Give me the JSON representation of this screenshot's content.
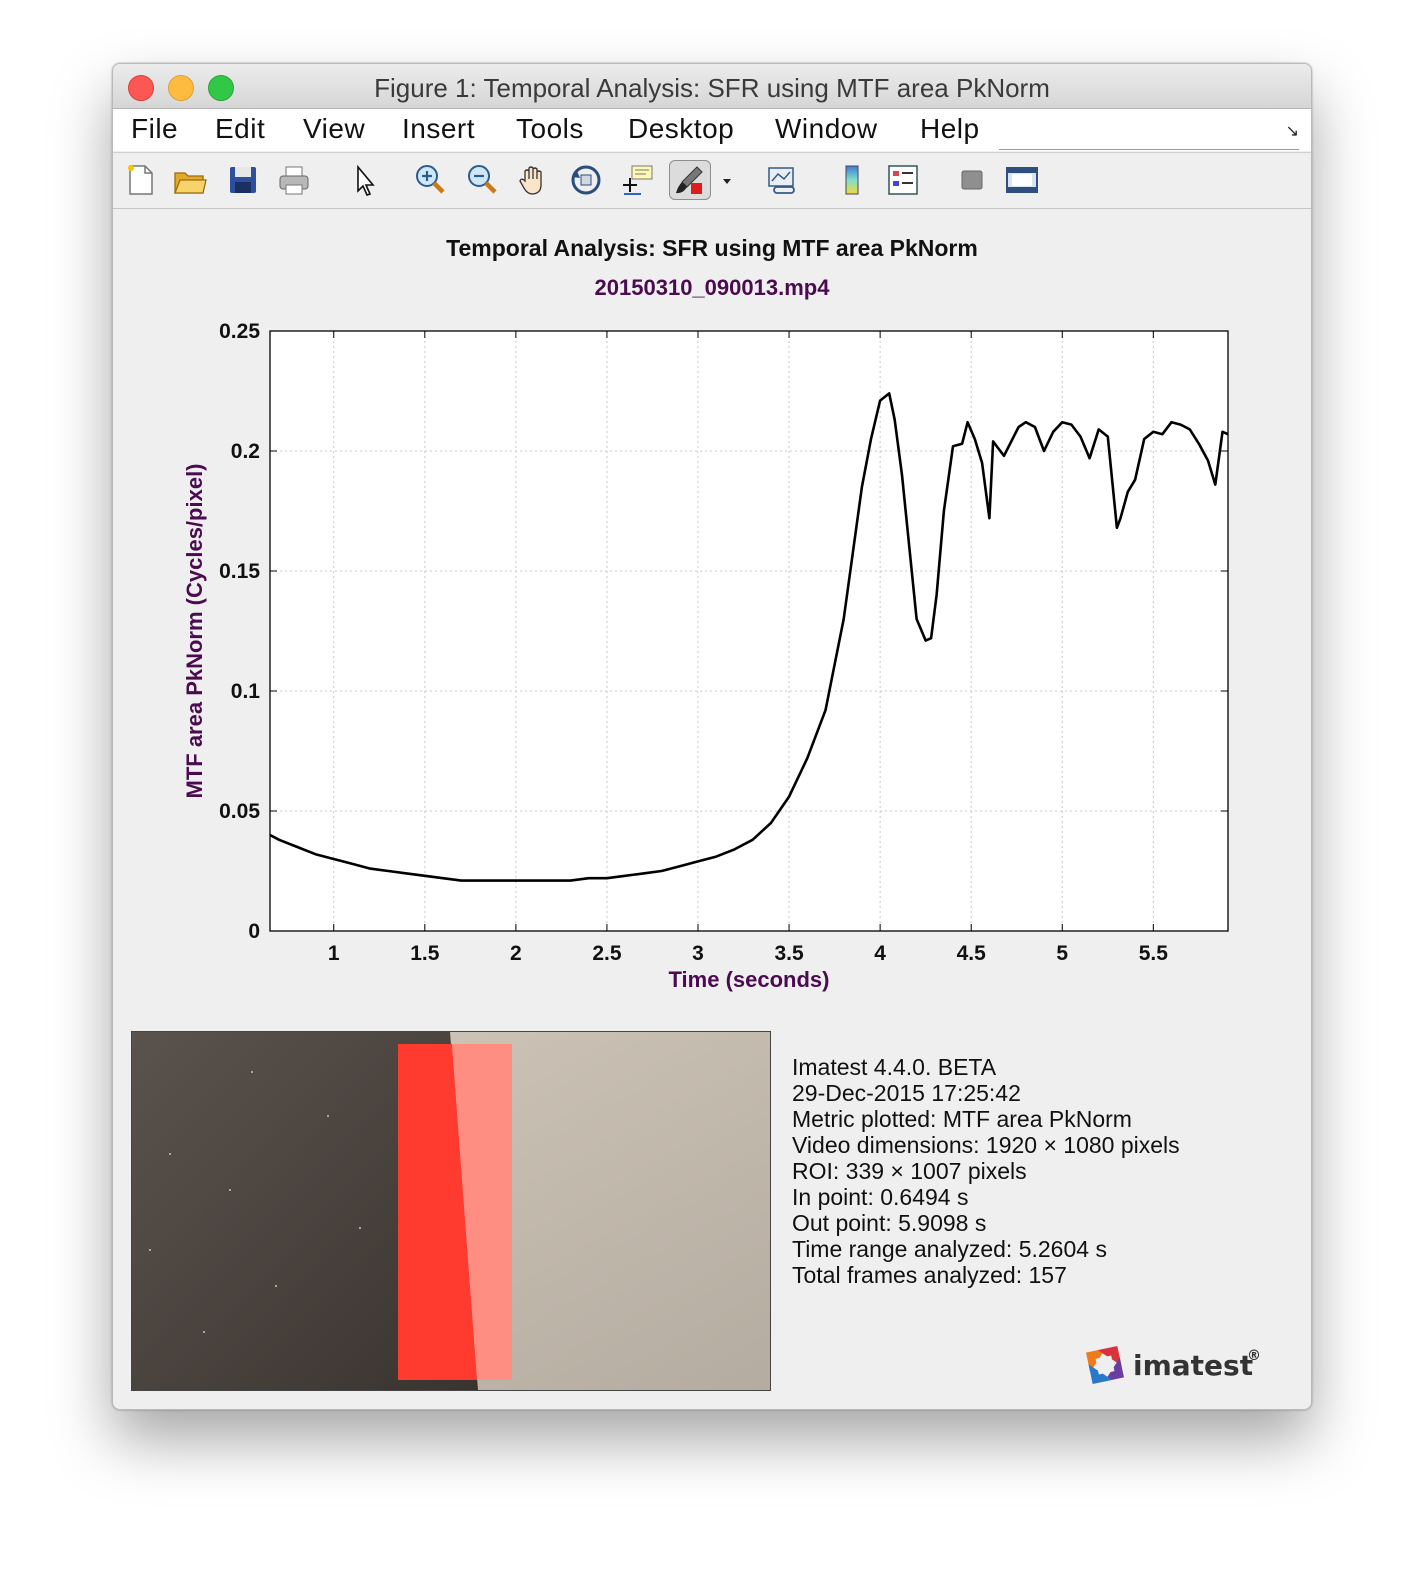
{
  "window": {
    "title": "Figure 1: Temporal Analysis: SFR using MTF area PkNorm"
  },
  "menu": [
    "File",
    "Edit",
    "View",
    "Insert",
    "Tools",
    "Desktop",
    "Window",
    "Help"
  ],
  "toolbar": {
    "icons": [
      "new-file-icon",
      "open-folder-icon",
      "save-icon",
      "print-icon",
      "pointer-icon",
      "zoom-in-icon",
      "zoom-out-icon",
      "pan-hand-icon",
      "rotate-3d-icon",
      "data-cursor-icon",
      "brush-icon",
      "dropdown-arrow-icon",
      "link-plot-icon",
      "colorbar-icon",
      "legend-icon",
      "hide-plot-tools-icon",
      "show-plot-tools-icon"
    ]
  },
  "figure": {
    "title": "Temporal Analysis: SFR using MTF area PkNorm",
    "subtitle": "20150310_090013.mp4"
  },
  "chart_data": {
    "type": "line",
    "title": "Temporal Analysis: SFR using MTF area PkNorm",
    "subtitle": "20150310_090013.mp4",
    "xlabel": "Time (seconds)",
    "ylabel": "MTF area PkNorm (Cycles/pixel)",
    "xlim": [
      0.65,
      5.91
    ],
    "ylim": [
      0,
      0.25
    ],
    "xticks": [
      "1",
      "1.5",
      "2",
      "2.5",
      "3",
      "3.5",
      "4",
      "4.5",
      "5",
      "5.5"
    ],
    "yticks": [
      "0",
      "0.05",
      "0.1",
      "0.15",
      "0.2",
      "0.25"
    ],
    "grid": true,
    "line_color": "#000000",
    "series": [
      {
        "x": [
          0.65,
          0.7,
          0.8,
          0.9,
          1.0,
          1.1,
          1.2,
          1.3,
          1.4,
          1.5,
          1.6,
          1.7,
          1.8,
          1.9,
          2.0,
          2.1,
          2.2,
          2.3,
          2.4,
          2.5,
          2.6,
          2.7,
          2.8,
          2.9,
          3.0,
          3.1,
          3.2,
          3.3,
          3.4,
          3.5,
          3.6,
          3.7,
          3.8,
          3.9,
          3.95,
          4.0,
          4.05,
          4.08,
          4.12,
          4.16,
          4.2,
          4.25,
          4.28,
          4.31,
          4.35,
          4.4,
          4.45,
          4.48,
          4.52,
          4.56,
          4.6,
          4.62,
          4.65,
          4.68,
          4.72,
          4.76,
          4.8,
          4.85,
          4.9,
          4.95,
          5.0,
          5.05,
          5.1,
          5.15,
          5.2,
          5.25,
          5.3,
          5.32,
          5.36,
          5.4,
          5.45,
          5.5,
          5.55,
          5.6,
          5.65,
          5.7,
          5.75,
          5.8,
          5.84,
          5.88,
          5.91
        ],
        "y": [
          0.04,
          0.038,
          0.035,
          0.032,
          0.03,
          0.028,
          0.026,
          0.025,
          0.024,
          0.023,
          0.022,
          0.021,
          0.021,
          0.021,
          0.021,
          0.021,
          0.021,
          0.021,
          0.022,
          0.022,
          0.023,
          0.024,
          0.025,
          0.027,
          0.029,
          0.031,
          0.034,
          0.038,
          0.045,
          0.056,
          0.072,
          0.092,
          0.13,
          0.185,
          0.205,
          0.221,
          0.224,
          0.213,
          0.19,
          0.16,
          0.13,
          0.121,
          0.122,
          0.14,
          0.175,
          0.202,
          0.203,
          0.212,
          0.205,
          0.195,
          0.172,
          0.204,
          0.201,
          0.198,
          0.204,
          0.21,
          0.212,
          0.21,
          0.2,
          0.208,
          0.212,
          0.211,
          0.206,
          0.197,
          0.209,
          0.206,
          0.168,
          0.172,
          0.183,
          0.188,
          0.205,
          0.208,
          0.207,
          0.212,
          0.211,
          0.209,
          0.203,
          0.196,
          0.186,
          0.208,
          0.207
        ]
      }
    ]
  },
  "info": [
    "Imatest 4.4.0. BETA",
    "29-Dec-2015 17:25:42",
    "Metric plotted: MTF area PkNorm",
    "Video dimensions: 1920 × 1080 pixels",
    "ROI: 339 × 1007 pixels",
    "In point: 0.6494 s",
    "Out point: 5.9098 s",
    "Time range analyzed: 5.2604 s",
    "Total frames analyzed: 157"
  ],
  "logo": {
    "text": "imatest",
    "mark": "®"
  }
}
